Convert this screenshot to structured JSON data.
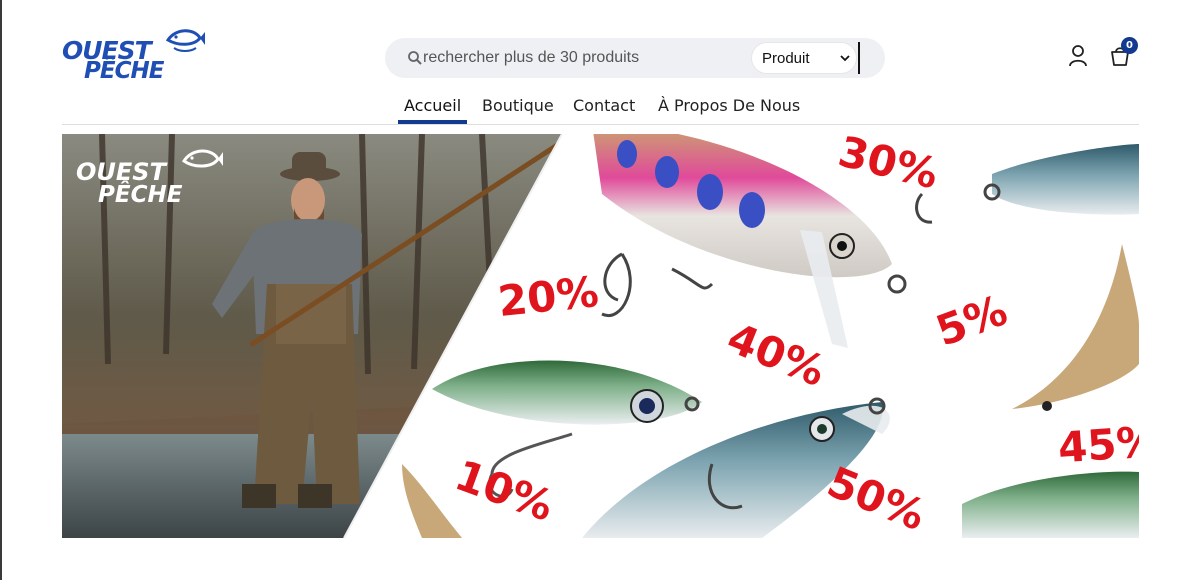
{
  "brand": {
    "line1": "OUEST",
    "line2": "PÊCHE"
  },
  "search": {
    "placeholder": "rechercher plus de 30 produits",
    "value": "",
    "category_selected": "Produit"
  },
  "cart": {
    "count": "0"
  },
  "nav": {
    "items": [
      {
        "label": "Accueil",
        "active": true
      },
      {
        "label": "Boutique"
      },
      {
        "label": "Contact"
      },
      {
        "label": "À Propos De Nous"
      }
    ]
  },
  "banner": {
    "logo_line1": "OUEST",
    "logo_line2": "PÊCHE",
    "discounts": [
      "30%",
      "20%",
      "40%",
      "5%",
      "10%",
      "50%",
      "45%"
    ]
  },
  "colors": {
    "brand_blue": "#1f4fb4",
    "accent_navy": "#123a8f",
    "promo_red": "#e0141c"
  },
  "icons": {
    "search": "search-icon",
    "user": "user-icon",
    "cart": "cart-icon",
    "select": "chevron-down-icon",
    "logo_fish": "fish-icon"
  }
}
